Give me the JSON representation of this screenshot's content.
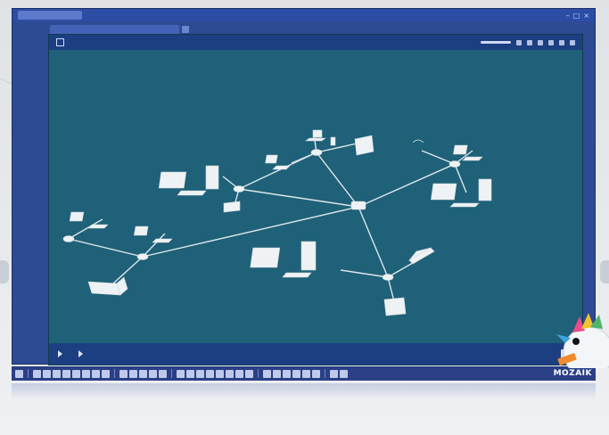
{
  "board": {
    "tab_label": "",
    "window_controls": [
      "–",
      "□",
      "×"
    ]
  },
  "lesson": {
    "title": "",
    "footer": {
      "item1": "",
      "item2": "",
      "item3": "",
      "page": ""
    }
  },
  "network": {
    "labels": {
      "left_cluster": "",
      "router": "",
      "right_cluster": ""
    }
  },
  "toolbar": {
    "logo": "MOZAIK"
  },
  "colors": {
    "canvas": "#1e6178",
    "board_frame": "#2e4a93",
    "header": "#1c3f82",
    "line": "#dfe6ea",
    "device": "#eef2f4"
  },
  "icons": [
    "laptop-icon",
    "desktop-icon",
    "router-icon",
    "switch-icon",
    "printer-icon",
    "play-icon"
  ]
}
